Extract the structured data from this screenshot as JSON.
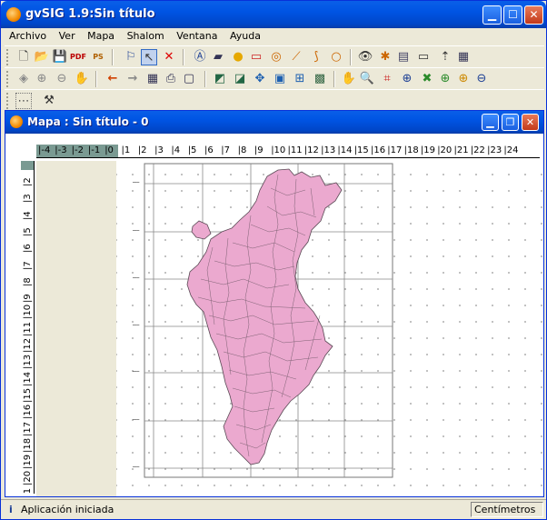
{
  "app": {
    "title": "gvSIG 1.9:Sin título"
  },
  "menu": [
    "Archivo",
    "Ver",
    "Mapa",
    "Shalom",
    "Ventana",
    "Ayuda"
  ],
  "toolbar": {
    "row1": [
      "new-doc-icon",
      "open-icon",
      "save-icon",
      "pdf-export-icon",
      "ps-export-icon",
      "info-select-icon",
      "pointer-icon",
      "delete-icon",
      "text-icon",
      "insert-view-icon",
      "point-icon",
      "rectangle-icon",
      "circle-icon",
      "polyline-icon",
      "polygon-icon",
      "ring-icon",
      "eye-icon",
      "legend-icon",
      "table-icon",
      "scale-bar-icon",
      "north-arrow-icon",
      "grid-icon"
    ],
    "row2": [
      "layers-icon",
      "zoom-in-icon",
      "zoom-out-icon",
      "pan-icon",
      "back-icon",
      "forward-icon",
      "layout-table-icon",
      "print-icon",
      "page-setup-icon",
      "map-zoom-full-icon",
      "map-zoom-prev-icon",
      "move-icon",
      "group-icon",
      "ungroup-icon",
      "image-icon",
      "hand-icon",
      "zoom-view-icon",
      "zoom-extent-icon",
      "zoom-select-icon",
      "zoom-layer-icon",
      "zoom-in-view-icon",
      "zoom-out-view-icon",
      "zoom-out2-icon"
    ],
    "row3": [
      "grid-toggle-icon",
      "tools-icon"
    ]
  },
  "map_window": {
    "title": "Mapa : Sin título - 0"
  },
  "ruler": {
    "h_labels": [
      "-4",
      "-3",
      "-2",
      "-1",
      "0",
      "1",
      "2",
      "3",
      "4",
      "5",
      "6",
      "7",
      "8",
      "9",
      "10",
      "11",
      "12",
      "13",
      "14",
      "15",
      "16",
      "17",
      "18",
      "19",
      "20",
      "21",
      "22",
      "23",
      "24"
    ],
    "v_labels": [
      "2",
      "3",
      "4",
      "5",
      "6",
      "7",
      "8",
      "9",
      "10",
      "11",
      "12",
      "13",
      "14",
      "15",
      "16",
      "17",
      "18",
      "19",
      "20",
      "21"
    ]
  },
  "status": {
    "message": "Aplicación iniciada",
    "units": "Centímetros"
  },
  "colors": {
    "map_fill": "#eba9cf",
    "map_stroke": "#5a4a55",
    "ruler_shade": "#7a9a92"
  }
}
